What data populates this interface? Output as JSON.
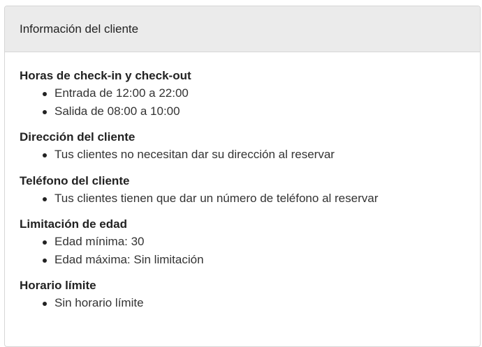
{
  "header": {
    "title": "Información del cliente"
  },
  "sections": [
    {
      "title": "Horas de check-in y check-out",
      "items": [
        "Entrada de 12:00 a 22:00",
        "Salida de 08:00 a 10:00"
      ]
    },
    {
      "title": "Dirección del cliente",
      "items": [
        "Tus clientes no necesitan dar su dirección al reservar"
      ]
    },
    {
      "title": "Teléfono del cliente",
      "items": [
        "Tus clientes tienen que dar un número de teléfono al reservar"
      ]
    },
    {
      "title": "Limitación de edad",
      "items": [
        "Edad mínima: 30",
        "Edad máxima: Sin limitación"
      ]
    },
    {
      "title": "Horario límite",
      "items": [
        "Sin horario límite"
      ]
    }
  ]
}
